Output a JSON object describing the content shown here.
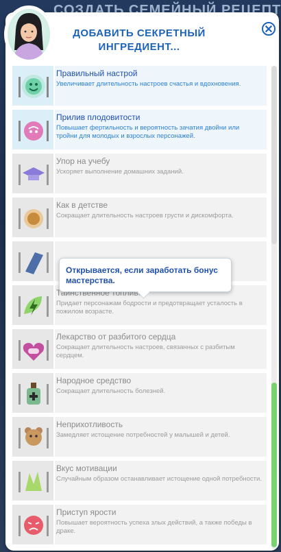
{
  "background": {
    "title": "СОЗДАТЬ СЕМЕЙНЫЙ РЕЦЕПТ"
  },
  "dialog": {
    "title_line1": "ДОБАВИТЬ СЕКРЕТНЫЙ",
    "title_line2": "ИНГРЕДИЕНТ...",
    "close_symbol": "✕"
  },
  "ingredients": [
    {
      "name": "Правильный настрой",
      "desc": "Увеличивает длительность настроев счастья и вдохновения.",
      "state": "available",
      "icon": "happy-face-icon"
    },
    {
      "name": "Прилив плодовитости",
      "desc": "Повышает фертильность и вероятность зачатия двойни или тройни для молодых и взрослых персонажей.",
      "state": "available",
      "icon": "fertility-icon"
    },
    {
      "name": "Упор на учебу",
      "desc": "Ускоряет выполнение домашних заданий.",
      "state": "locked",
      "icon": "graduation-cap-icon"
    },
    {
      "name": "Как в детстве",
      "desc": "Сокращает длительность настроев грусти и дискомфорта.",
      "state": "locked",
      "icon": "soup-bowl-icon"
    },
    {
      "name": "",
      "desc": "",
      "state": "locked",
      "icon": "plate-icon"
    },
    {
      "name": "Таинственное топливо",
      "desc": "Придает персонажам бодрости и предотвращает усталость в пожилом возрасте.",
      "state": "locked",
      "icon": "energy-leaf-icon"
    },
    {
      "name": "Лекарство от разбитого сердца",
      "desc": "Сокращает длительность настроев, связанных с разбитым сердцем.",
      "state": "locked",
      "icon": "broken-heart-pill-icon"
    },
    {
      "name": "Народное средство",
      "desc": "Сокращает длительность болезней.",
      "state": "locked",
      "icon": "medicine-bottle-icon"
    },
    {
      "name": "Неприхотливость",
      "desc": "Замедляет истощение потребностей у малышей и детей.",
      "state": "locked",
      "icon": "teddy-bear-icon"
    },
    {
      "name": "Вкус мотивации",
      "desc": "Случайным образом останавливает истощение одной потребности.",
      "state": "locked",
      "icon": "motivation-icon"
    },
    {
      "name": "Приступ ярости",
      "desc": "Повышает вероятность успеха злых действий, а также победы в драке.",
      "state": "locked",
      "icon": "angry-face-icon"
    }
  ],
  "tooltip": {
    "text": "Открывается, если заработать бонус мастерства."
  },
  "colors": {
    "accent": "#1d63b8",
    "active_row": "#eef6fb",
    "locked_row": "#f2f2f2",
    "scroll_green": "#79d16f"
  }
}
